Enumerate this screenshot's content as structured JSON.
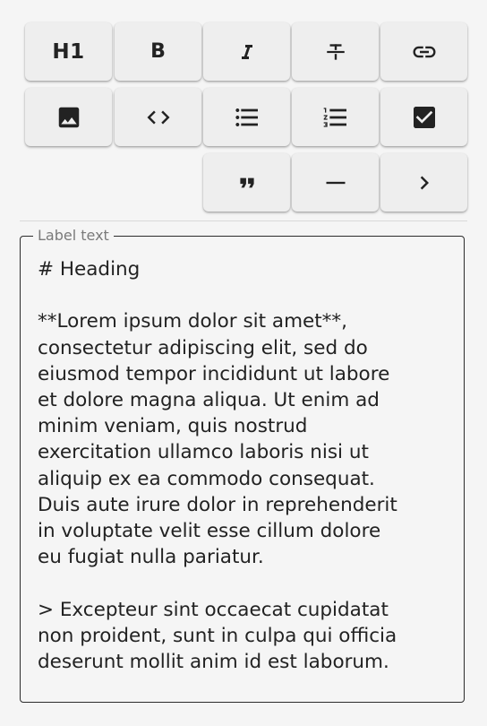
{
  "toolbar": {
    "buttons": [
      {
        "name": "heading",
        "label": "H1",
        "icon": "heading-icon"
      },
      {
        "name": "bold",
        "label": "B",
        "icon": "bold-icon"
      },
      {
        "name": "italic",
        "label": "I",
        "icon": "italic-icon"
      },
      {
        "name": "strikethrough",
        "icon": "strikethrough-icon"
      },
      {
        "name": "link",
        "icon": "link-icon"
      },
      {
        "name": "image",
        "icon": "image-icon"
      },
      {
        "name": "code",
        "icon": "code-icon"
      },
      {
        "name": "bulleted-list",
        "icon": "bulleted-list-icon"
      },
      {
        "name": "numbered-list",
        "icon": "numbered-list-icon"
      },
      {
        "name": "checklist",
        "icon": "checkbox-icon"
      },
      {
        "name": "quote",
        "icon": "quote-icon"
      },
      {
        "name": "horizontal-rule",
        "icon": "horizontal-rule-icon"
      },
      {
        "name": "more",
        "icon": "chevron-right-icon"
      }
    ]
  },
  "field": {
    "label": "Label text",
    "value": "# Heading\n\n**Lorem ipsum dolor sit amet**,\nconsectetur adipiscing elit, sed do\neiusmod tempor incididunt ut labore\net dolore magna aliqua. Ut enim ad\nminim veniam, quis nostrud\nexercitation ullamco laboris nisi ut\naliquip ex ea commodo consequat.\nDuis aute irure dolor in reprehenderit\nin voluptate velit esse cillum dolore\neu fugiat nulla pariatur.\n\n> Excepteur sint occaecat cupidatat\nnon proident, sunt in culpa qui officia\ndeserunt mollit anim id est laborum."
  }
}
